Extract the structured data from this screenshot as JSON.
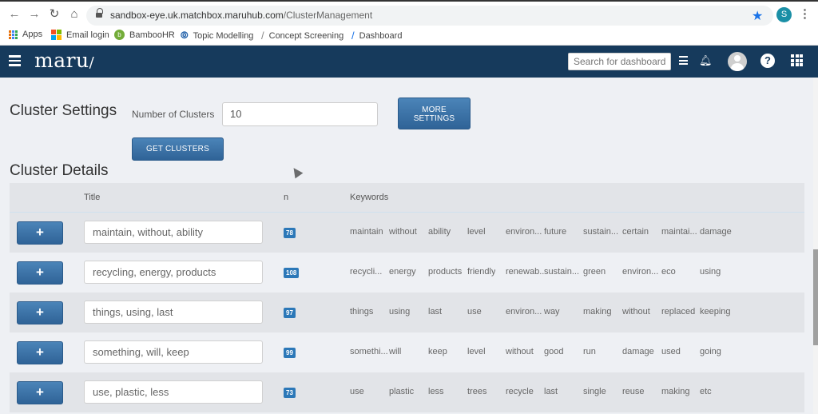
{
  "browser": {
    "url_domain": "sandbox-eye.uk.matchbox.maruhub.com",
    "url_path": "/ClusterManagement",
    "profile_initial": "S",
    "bookmarks": [
      {
        "label": "Apps",
        "icon": "apps-grid-icon"
      },
      {
        "label": "Email login",
        "icon": "microsoft-icon"
      },
      {
        "label": "BambooHR",
        "icon": "bamboohr-icon"
      },
      {
        "label": "Topic Modelling",
        "icon": "topic-modelling-icon"
      },
      {
        "label": "Concept Screening",
        "icon": "slash-icon"
      },
      {
        "label": "Dashboard",
        "icon": "slash-icon"
      }
    ]
  },
  "header": {
    "logo": "maru",
    "logo_suffix": "/",
    "search_placeholder": "Search for dashboards",
    "help_glyph": "?"
  },
  "settings": {
    "heading": "Cluster Settings",
    "clusters_label": "Number of Clusters",
    "clusters_value": "10",
    "more_settings_line1": "MORE",
    "more_settings_line2": "SETTINGS",
    "get_clusters_label": "GET CLUSTERS"
  },
  "details": {
    "heading": "Cluster Details",
    "columns": {
      "title": "Title",
      "n": "n",
      "keywords": "Keywords"
    },
    "add_glyph": "+",
    "rows": [
      {
        "title": "maintain, without, ability",
        "n": "78",
        "keywords": [
          "maintain",
          "without",
          "ability",
          "level",
          "environ...",
          "future",
          "sustain...",
          "certain",
          "maintai...",
          "damage"
        ]
      },
      {
        "title": "recycling, energy, products",
        "n": "108",
        "keywords": [
          "recycli...",
          "energy",
          "products",
          "friendly",
          "renewab...",
          "sustain...",
          "green",
          "environ...",
          "eco",
          "using"
        ]
      },
      {
        "title": "things, using, last",
        "n": "97",
        "keywords": [
          "things",
          "using",
          "last",
          "use",
          "environ...",
          "way",
          "making",
          "without",
          "replaced",
          "keeping"
        ]
      },
      {
        "title": "something, will, keep",
        "n": "99",
        "keywords": [
          "somethi...",
          "will",
          "keep",
          "level",
          "without",
          "good",
          "run",
          "damage",
          "used",
          "going"
        ]
      },
      {
        "title": "use, plastic, less",
        "n": "73",
        "keywords": [
          "use",
          "plastic",
          "less",
          "trees",
          "recycle",
          "last",
          "single",
          "reuse",
          "making",
          "etc"
        ]
      }
    ]
  },
  "colors": {
    "header_bg": "#163a5c",
    "button_blue": "#3a70a6",
    "badge_blue": "#2c78b8",
    "star_blue": "#1a73e8"
  }
}
